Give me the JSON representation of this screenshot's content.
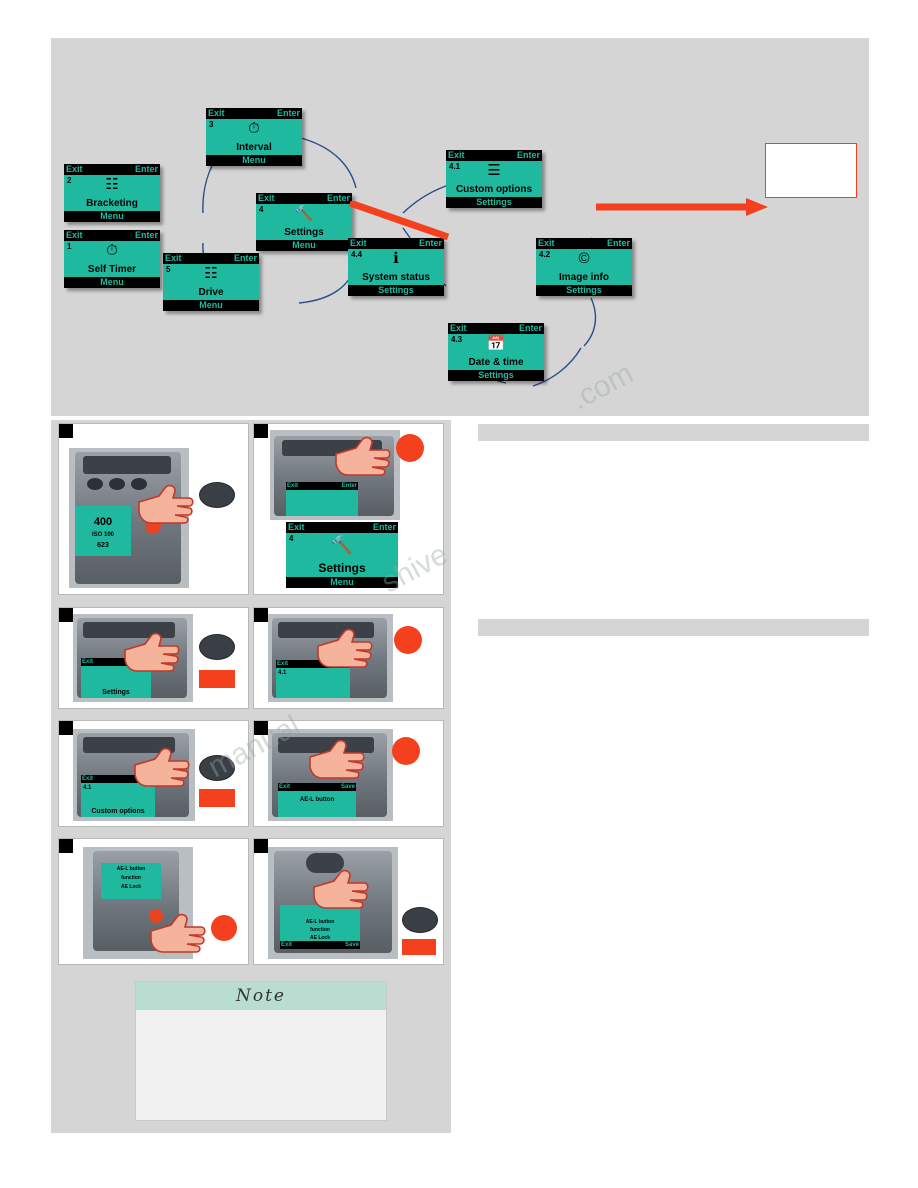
{
  "diagram": {
    "menus": [
      {
        "num": "3",
        "title": "Interval",
        "icon": "interval-icon",
        "top_left": "Exit",
        "top_right": "Enter",
        "bottom": "Menu"
      },
      {
        "num": "2",
        "title": "Bracketing",
        "icon": "bracketing-icon",
        "top_left": "Exit",
        "top_right": "Enter",
        "bottom": "Menu"
      },
      {
        "num": "1",
        "title": "Self Timer",
        "icon": "self-timer-icon",
        "top_left": "Exit",
        "top_right": "Enter",
        "bottom": "Menu"
      },
      {
        "num": "4",
        "title": "Settings",
        "icon": "settings-tools-icon",
        "top_left": "Exit",
        "top_right": "Enter",
        "bottom": "Menu"
      },
      {
        "num": "5",
        "title": "Drive",
        "icon": "drive-icon",
        "top_left": "Exit",
        "top_right": "Enter",
        "bottom": "Menu"
      },
      {
        "num": "4.1",
        "title": "Custom options",
        "icon": "custom-options-icon",
        "top_left": "Exit",
        "top_right": "Enter",
        "bottom": "Settings"
      },
      {
        "num": "4.2",
        "title": "Image info",
        "icon": "image-info-icon",
        "top_left": "Exit",
        "top_right": "Enter",
        "bottom": "Settings"
      },
      {
        "num": "4.3",
        "title": "Date & time",
        "icon": "date-time-icon",
        "top_left": "Exit",
        "top_right": "Enter",
        "bottom": "Settings"
      },
      {
        "num": "4.4",
        "title": "System status",
        "icon": "system-status-icon",
        "top_left": "Exit",
        "top_right": "Enter",
        "bottom": "Settings"
      }
    ],
    "callout_box_label": ""
  },
  "steps": {
    "numbers": [
      "",
      "",
      "",
      "",
      "",
      "",
      "",
      ""
    ],
    "screens": {
      "settings": {
        "num": "4",
        "title": "Settings",
        "exit": "Exit",
        "enter": "Enter",
        "menu": "Menu"
      },
      "settings_small": {
        "title": "Settings",
        "exit": "Exit",
        "enter": "Enter"
      },
      "custom_options": {
        "num": "4.1",
        "title": "Custom options",
        "exit": "Exit",
        "enter": "Enter"
      },
      "ael_button": {
        "title": "AE-L button",
        "exit": "Exit",
        "save": "Save"
      },
      "ael_function": {
        "line1": "AE-L button",
        "line2": "function",
        "line3": "AE Lock",
        "exit": "Exit",
        "save": "Save"
      },
      "camera_top_readout": {
        "iso": "ISO 100",
        "frames": "623",
        "shutter": "400"
      }
    }
  },
  "note": {
    "title": "Note",
    "body": ""
  },
  "right_column": {
    "band_one_text": "",
    "band_two_text": ""
  },
  "watermark": {
    "line1": ".com",
    "line2": "shive",
    "line3": "manual"
  },
  "colors": {
    "lcd_green": "#1fb9a0",
    "accent_red": "#f4401c",
    "panel_gray": "#d5d5d5",
    "note_header": "#b9ddd0"
  }
}
